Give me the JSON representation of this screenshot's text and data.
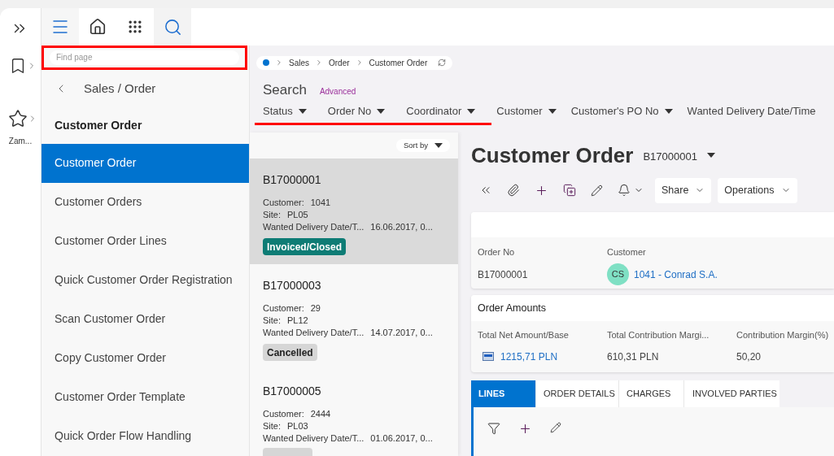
{
  "rail": {
    "label": "Zam..."
  },
  "nav": {
    "search": {
      "placeholder": "Find page",
      "highlighted": true
    },
    "back_label": "Sales / Order",
    "heading": "Customer Order",
    "items": [
      {
        "label": "Customer Order",
        "selected": true
      },
      {
        "label": "Customer Orders",
        "selected": false
      },
      {
        "label": "Customer Order Lines",
        "selected": false
      },
      {
        "label": "Quick Customer Order Registration",
        "selected": false
      },
      {
        "label": "Scan Customer Order",
        "selected": false
      },
      {
        "label": "Copy Customer Order",
        "selected": false
      },
      {
        "label": "Customer Order Template",
        "selected": false
      },
      {
        "label": "Quick Order Flow Handling",
        "selected": false
      }
    ]
  },
  "breadcrumb": [
    "Sales",
    "Order",
    "Customer Order"
  ],
  "search": {
    "title": "Search",
    "advanced": "Advanced",
    "filters": [
      {
        "label": "Status",
        "caret": true,
        "underlined": true
      },
      {
        "label": "Order No",
        "caret": true,
        "underlined": true
      },
      {
        "label": "Coordinator",
        "caret": true,
        "underlined": true
      },
      {
        "label": "Customer",
        "caret": true,
        "underlined": false
      },
      {
        "label": "Customer's PO No",
        "caret": true,
        "underlined": false
      },
      {
        "label": "Wanted Delivery Date/Time",
        "caret": false,
        "underlined": false
      }
    ]
  },
  "list": {
    "sort_label": "Sort by",
    "cards": [
      {
        "order_no": "B17000001",
        "selected": true,
        "customer_label": "Customer:",
        "customer": "1041",
        "site_label": "Site:",
        "site": "PL05",
        "delivery_label": "Wanted Delivery Date/T...",
        "delivery": "16.06.2017, 0...",
        "status": {
          "label": "Invoiced/Closed",
          "kind": "closed"
        }
      },
      {
        "order_no": "B17000003",
        "selected": false,
        "customer_label": "Customer:",
        "customer": "29",
        "site_label": "Site:",
        "site": "PL12",
        "delivery_label": "Wanted Delivery Date/T...",
        "delivery": "14.07.2017, 0...",
        "status": {
          "label": "Cancelled",
          "kind": "cancelled"
        }
      },
      {
        "order_no": "B17000005",
        "selected": false,
        "customer_label": "Customer:",
        "customer": "2444",
        "site_label": "Site:",
        "site": "PL03",
        "delivery_label": "Wanted Delivery Date/T...",
        "delivery": "01.06.2017, 0...",
        "status": {
          "kind": "cancelled"
        }
      }
    ]
  },
  "detail": {
    "title": "Customer Order",
    "record": "B17000001",
    "actions": [
      "Share",
      "Operations"
    ],
    "header_fields": [
      {
        "label": "Order No",
        "value": "B17000001",
        "kind": "text"
      },
      {
        "label": "Customer",
        "value": "1041 - Conrad S.A.",
        "avatar": "CS",
        "kind": "link"
      }
    ],
    "amounts": {
      "title": "Order Amounts",
      "fields": [
        {
          "label": "Total Net Amount/Base",
          "value": "1215,71 PLN",
          "kind": "link"
        },
        {
          "label": "Total Contribution Margi...",
          "value": "610,31 PLN",
          "kind": "text"
        },
        {
          "label": "Contribution Margin(%)",
          "value": "50,20",
          "kind": "text"
        }
      ]
    },
    "tabs": [
      {
        "label": "LINES",
        "selected": true
      },
      {
        "label": "ORDER DETAILS",
        "selected": false
      },
      {
        "label": "CHARGES",
        "selected": false
      },
      {
        "label": "INVOLVED PARTIES",
        "selected": false
      }
    ]
  }
}
